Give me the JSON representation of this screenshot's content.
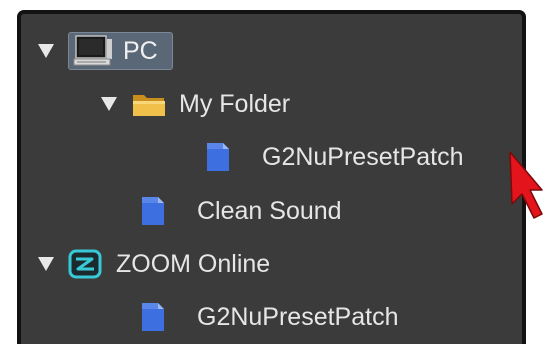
{
  "tree": {
    "items": [
      {
        "label": "PC",
        "icon": "computer-icon",
        "expanded": true,
        "selected": true
      },
      {
        "label": "My Folder",
        "icon": "folder-icon",
        "expanded": true
      },
      {
        "label": "G2NuPresetPatch",
        "icon": "patch-file-icon"
      },
      {
        "label": "Clean Sound",
        "icon": "patch-file-icon"
      },
      {
        "label": "ZOOM Online",
        "icon": "zoom-online-icon",
        "expanded": true
      },
      {
        "label": "G2NuPresetPatch",
        "icon": "patch-file-icon"
      }
    ]
  },
  "colors": {
    "panel_bg": "#3b3b3b",
    "panel_border": "#121212",
    "selection_bg": "#5a6776",
    "text": "#e6e6e6",
    "file_icon": "#3d6fe0",
    "folder_icon": "#e8b440",
    "zoom_icon": "#39c9d6",
    "cursor": "#e3141b"
  }
}
